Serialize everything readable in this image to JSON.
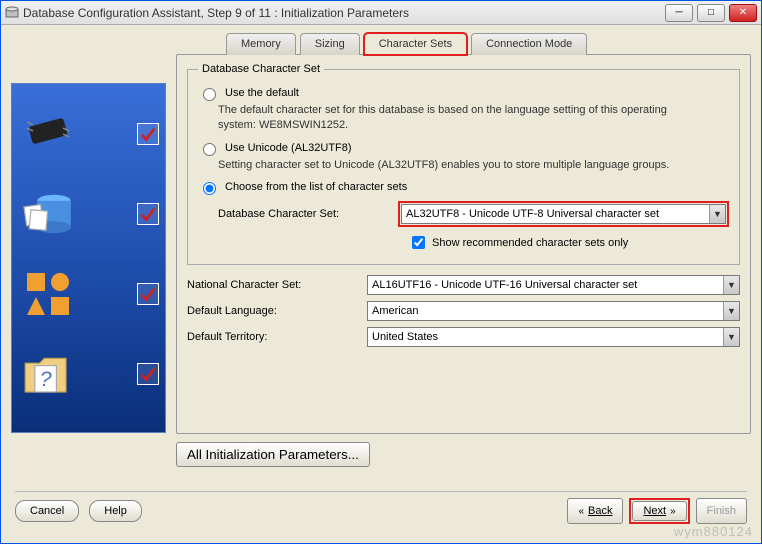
{
  "window": {
    "title": "Database Configuration Assistant, Step 9 of 11 : Initialization Parameters"
  },
  "tabs": {
    "memory": "Memory",
    "sizing": "Sizing",
    "charsets": "Character Sets",
    "connmode": "Connection Mode"
  },
  "group": {
    "legend": "Database Character Set",
    "opt_default": {
      "label": "Use the default",
      "desc": "The default character set for this database is based on the language setting of this operating system: WE8MSWIN1252."
    },
    "opt_unicode": {
      "label": "Use Unicode (AL32UTF8)",
      "desc": "Setting character set to Unicode (AL32UTF8) enables you to store multiple language groups."
    },
    "opt_choose": {
      "label": "Choose from the list of character sets",
      "db_charset_label": "Database Character Set:",
      "db_charset_value": "AL32UTF8 - Unicode UTF-8 Universal character set",
      "recommended_label": "Show recommended character sets only"
    }
  },
  "national": {
    "label": "National Character Set:",
    "value": "AL16UTF16 - Unicode UTF-16 Universal character set"
  },
  "lang": {
    "label": "Default Language:",
    "value": "American"
  },
  "territory": {
    "label": "Default Territory:",
    "value": "United States"
  },
  "all_params": "All Initialization Parameters...",
  "buttons": {
    "cancel": "Cancel",
    "help": "Help",
    "back": "Back",
    "next": "Next",
    "finish": "Finish"
  },
  "sidebar_icons": [
    "chip-icon",
    "database-icon",
    "tiles-icon",
    "question-folder-icon"
  ],
  "watermark": "wym880124"
}
